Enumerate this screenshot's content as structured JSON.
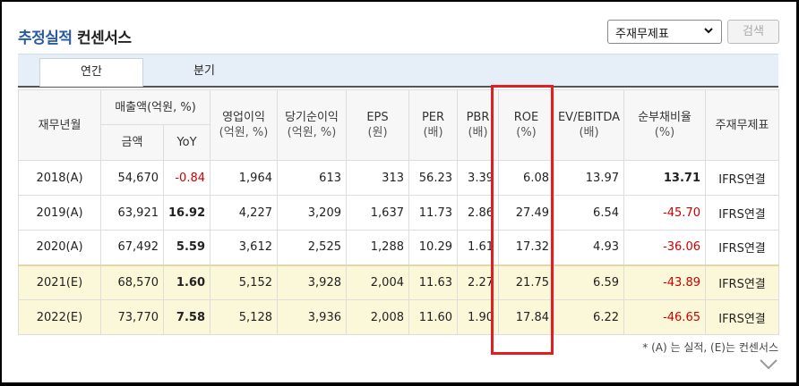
{
  "header": {
    "title_part1": "추정실적",
    "title_part2": "컨센서스",
    "select_value": "주재무제표",
    "search_label": "검색"
  },
  "tabs": [
    {
      "label": "연간",
      "active": true
    },
    {
      "label": "분기",
      "active": false
    }
  ],
  "table": {
    "headers": {
      "period": "재무년월",
      "sales_group": "매출액(억원, %)",
      "sales_amount": "금액",
      "sales_yoy": "YoY",
      "op_income": "영업이익",
      "op_income_unit": "(억원, %)",
      "net_income": "당기순이익",
      "net_income_unit": "(억원, %)",
      "eps": "EPS",
      "eps_unit": "(원)",
      "per": "PER",
      "per_unit": "(배)",
      "pbr": "PBR",
      "pbr_unit": "(배)",
      "roe": "ROE",
      "roe_unit": "(%)",
      "ev_ebitda": "EV/EBITDA",
      "ev_ebitda_unit": "(배)",
      "net_debt": "순부채비율",
      "net_debt_unit": "(%)",
      "fs_type": "주재무제표"
    },
    "rows": [
      {
        "period": "2018(A)",
        "sales": "54,670",
        "yoy": "-0.84",
        "op": "1,964",
        "net": "613",
        "eps": "313",
        "per": "56.23",
        "pbr": "3.39",
        "roe": "6.08",
        "ev": "13.97",
        "debt": "13.71",
        "fs": "IFRS연결"
      },
      {
        "period": "2019(A)",
        "sales": "63,921",
        "yoy": "16.92",
        "op": "4,227",
        "net": "3,209",
        "eps": "1,637",
        "per": "11.73",
        "pbr": "2.86",
        "roe": "27.49",
        "ev": "6.54",
        "debt": "-45.70",
        "fs": "IFRS연결"
      },
      {
        "period": "2020(A)",
        "sales": "67,492",
        "yoy": "5.59",
        "op": "3,612",
        "net": "2,525",
        "eps": "1,288",
        "per": "10.29",
        "pbr": "1.61",
        "roe": "17.32",
        "ev": "4.93",
        "debt": "-36.06",
        "fs": "IFRS연결"
      },
      {
        "period": "2021(E)",
        "sales": "68,570",
        "yoy": "1.60",
        "op": "5,152",
        "net": "3,928",
        "eps": "2,004",
        "per": "11.63",
        "pbr": "2.27",
        "roe": "21.75",
        "ev": "6.59",
        "debt": "-43.89",
        "fs": "IFRS연결"
      },
      {
        "period": "2022(E)",
        "sales": "73,770",
        "yoy": "7.58",
        "op": "5,128",
        "net": "3,936",
        "eps": "2,008",
        "per": "11.60",
        "pbr": "1.90",
        "roe": "17.84",
        "ev": "6.22",
        "debt": "-46.65",
        "fs": "IFRS연결"
      }
    ]
  },
  "note": "* (A) 는 실적, (E)는 컨센서스",
  "colors": {
    "title_blue": "#2b5aa5",
    "negative_red": "#cc0000",
    "estimate_bg": "#fbf7d9",
    "highlight_box": "#e02020"
  }
}
